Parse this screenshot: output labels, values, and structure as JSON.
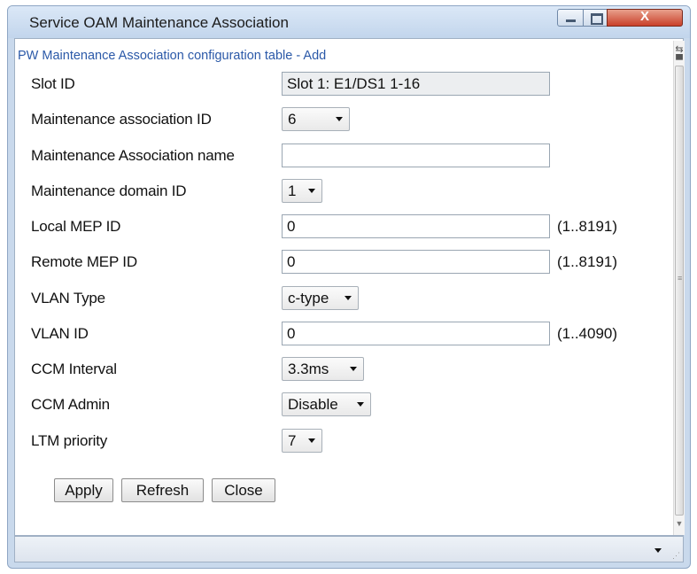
{
  "window": {
    "title": "Service OAM Maintenance Association",
    "close_glyph": "X"
  },
  "form": {
    "header": "PW Maintenance Association configuration table - Add",
    "fields": {
      "slot_id": {
        "label": "Slot ID",
        "value": "Slot 1: E1/DS1 1-16"
      },
      "ma_id": {
        "label": "Maintenance association ID",
        "value": "6"
      },
      "ma_name": {
        "label": "Maintenance Association name",
        "value": ""
      },
      "md_id": {
        "label": "Maintenance domain ID",
        "value": "1"
      },
      "local_mep": {
        "label": "Local MEP ID",
        "value": "0",
        "range": "(1..8191)"
      },
      "remote_mep": {
        "label": "Remote MEP ID",
        "value": "0",
        "range": "(1..8191)"
      },
      "vlan_type": {
        "label": "VLAN Type",
        "value": "c-type"
      },
      "vlan_id": {
        "label": "VLAN ID",
        "value": "0",
        "range": "(1..4090)"
      },
      "ccm_interval": {
        "label": "CCM Interval",
        "value": "3.3ms"
      },
      "ccm_admin": {
        "label": "CCM Admin",
        "value": "Disable"
      },
      "ltm_priority": {
        "label": "LTM priority",
        "value": "7"
      }
    }
  },
  "buttons": {
    "apply": "Apply",
    "refresh": "Refresh",
    "close": "Close"
  },
  "icons": {
    "minimize": "minimize-icon",
    "maximize": "maximize-icon",
    "close": "close-icon",
    "dropdown": "chevron-down-icon"
  },
  "colors": {
    "title_bar": "#c2d5ec",
    "close_button": "#c9402a",
    "header_text": "#2b59a8"
  }
}
